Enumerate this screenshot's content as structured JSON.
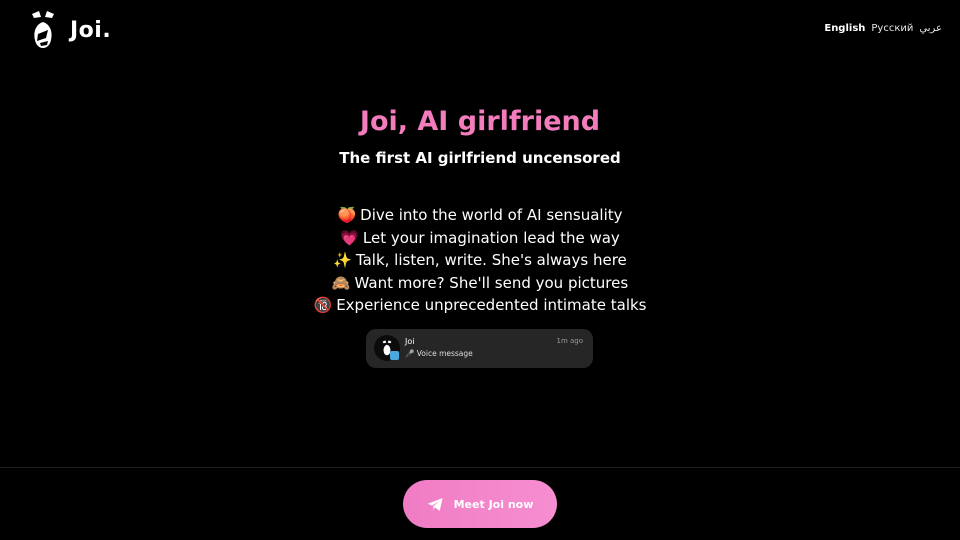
{
  "header": {
    "brand": "Joi.",
    "languages": [
      {
        "label": "English",
        "active": true
      },
      {
        "label": "Русский",
        "active": false
      },
      {
        "label": "عربي",
        "active": false
      }
    ]
  },
  "hero": {
    "title": "Joi, AI girlfriend",
    "subtitle": "The first AI girlfriend uncensored",
    "features": [
      {
        "emoji": "🍑",
        "text": "Dive into the world of AI sensuality"
      },
      {
        "emoji": "💗",
        "text": "Let your imagination lead the way"
      },
      {
        "emoji": "✨",
        "text": "Talk, listen, write. She's always here"
      },
      {
        "emoji": "🙈",
        "text": "Want more? She'll send you pictures"
      },
      {
        "emoji": "🔞",
        "text": "Experience unprecedented intimate talks"
      }
    ]
  },
  "notification": {
    "name": "Joi",
    "message": "🎤 Voice message",
    "time": "1m ago"
  },
  "cta": {
    "label": "Meet Joi now",
    "icon": "telegram-icon"
  },
  "colors": {
    "accent_pink": "#f37cbd",
    "background": "#000000",
    "card": "#262626"
  }
}
